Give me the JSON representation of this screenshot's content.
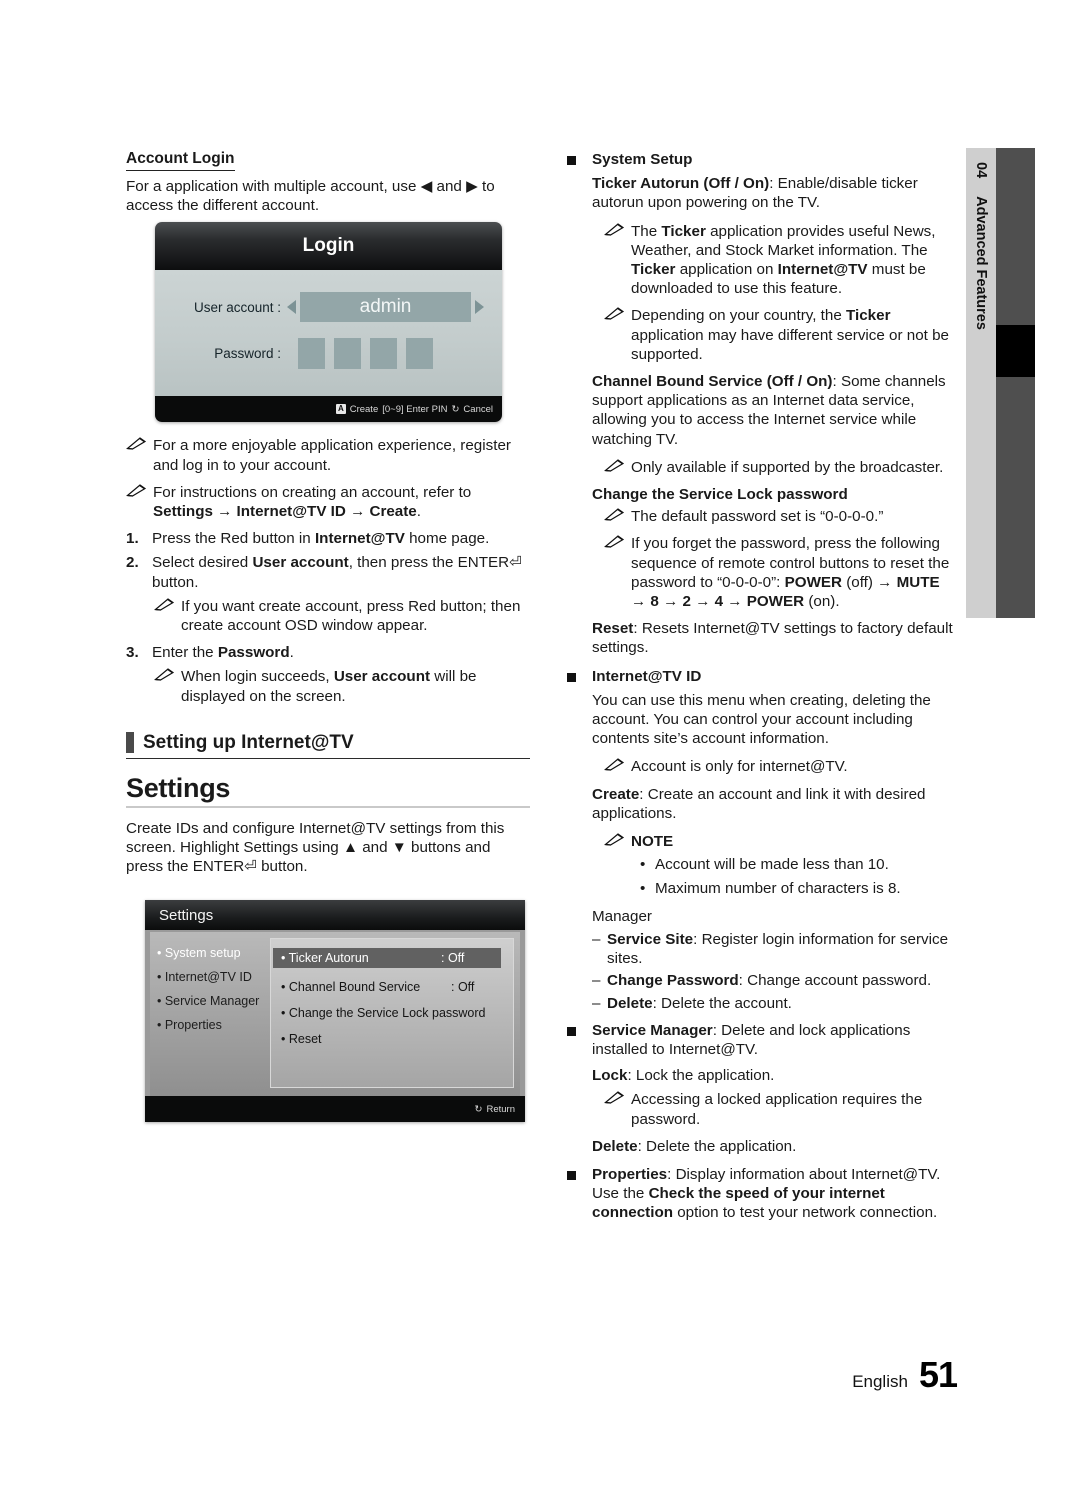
{
  "left": {
    "account_login_heading": "Account Login",
    "account_login_intro": "For a application with multiple account, use ◀ and ▶ to access the different account.",
    "login_osd": {
      "title": "Login",
      "user_account_label": "User account :",
      "user_account_value": "admin",
      "password_label": "Password :",
      "password_cells": 4,
      "footer_key": "A",
      "footer_create": "Create",
      "footer_enter_pin": "[0~9] Enter PIN",
      "footer_return_icon": "↻",
      "footer_cancel": "Cancel"
    },
    "notes": [
      "For a more enjoyable application experience, register and log in to your account.",
      "For instructions on creating an account, refer to Settings → Internet@TV ID → Create."
    ],
    "note2_plain_prefix": "For instructions on creating an account, refer to ",
    "note2_bold": "Settings → Internet@TV ID → Create",
    "steps": [
      {
        "n": "1.",
        "plain1": "Press the Red button in ",
        "bold": "Internet@TV",
        "plain2": " home page."
      },
      {
        "n": "2.",
        "plain1": "Select desired ",
        "bold": "User account",
        "plain2": ", then press the ENTER⏎ button."
      },
      {
        "n": "3.",
        "plain1": "Enter the ",
        "bold": "Password",
        "plain2": "."
      }
    ],
    "step2_note": "If you want create account, press Red button; then create account OSD window appear.",
    "step3_note_prefix": "When login succeeds, ",
    "step3_note_bold": "User account",
    "step3_note_suffix": " will be displayed on the screen.",
    "section_title": "Setting up Internet@TV",
    "settings_heading": "Settings",
    "settings_intro": "Create IDs and configure Internet@TV settings from this screen. Highlight Settings using ▲ and ▼ buttons and press the ENTER⏎ button.",
    "settings_osd": {
      "title": "Settings",
      "menu": [
        {
          "label": "• System setup",
          "selected": true
        },
        {
          "label": "• Internet@TV ID",
          "selected": false
        },
        {
          "label": "• Service Manager",
          "selected": false
        },
        {
          "label": "• Properties",
          "selected": false
        }
      ],
      "items": [
        {
          "label": "• Ticker Autorun",
          "value": ": Off",
          "highlight": true
        },
        {
          "label": "• Channel Bound Service",
          "value": ": Off",
          "highlight": false
        },
        {
          "label": "• Change the Service Lock password",
          "value": "",
          "highlight": false
        },
        {
          "label": "• Reset",
          "value": "",
          "highlight": false
        }
      ],
      "return_icon": "↻",
      "return_label": "Return"
    }
  },
  "right": {
    "system_setup_heading": "System Setup",
    "ticker_autorun_bold": "Ticker Autorun (Off / On)",
    "ticker_autorun_text": ": Enable/disable ticker autorun upon powering on the TV.",
    "ticker_note_1": "The Ticker application provides useful News, Weather, and Stock Market information. The Ticker application on Internet@TV must be downloaded to use this feature.",
    "ticker_note_2": "Depending on your country, the Ticker application may have different service or not be supported.",
    "channel_bound_bold": "Channel Bound Service (Off / On)",
    "channel_bound_text": ": Some channels support applications as an Internet data service, allowing you to access the Internet service while watching TV.",
    "channel_bound_note": "Only available if supported by the broadcaster.",
    "change_lock_heading": "Change the Service Lock password",
    "change_lock_note_1": "The default password set is “0-0-0-0.”",
    "change_lock_note_2": "If you forget the password, press the following sequence of remote control buttons to reset the password to “0-0-0-0”: POWER (off) → MUTE → 8 → 2 → 4 → POWER (on).",
    "reset_bold": "Reset",
    "reset_text": ": Resets Internet@TV settings to factory default settings.",
    "internet_tv_id_heading": "Internet@TV ID",
    "internet_tv_id_text": "You can use this menu when creating, deleting the account. You can control your account including contents site’s account information.",
    "internet_tv_id_note": "Account is only for internet@TV.",
    "create_bold": "Create",
    "create_text": ": Create an account and link it with desired applications.",
    "note_label": "NOTE",
    "note_bullets": [
      "Account will be made less than 10.",
      "Maximum number of characters is 8."
    ],
    "manager_heading": "Manager",
    "manager_items": [
      {
        "bold": "Service Site",
        "text": ": Register login information for service sites."
      },
      {
        "bold": "Change Password",
        "text": ": Change account password."
      },
      {
        "bold": "Delete",
        "text": ": Delete the account."
      }
    ],
    "service_manager_bold": "Service Manager",
    "service_manager_text": ": Delete and lock applications installed to Internet@TV.",
    "lock_bold": "Lock",
    "lock_text": ": Lock the application.",
    "lock_note": "Accessing a locked application requires the password.",
    "delete_bold": "Delete",
    "delete_text": ": Delete the application.",
    "properties_bold": "Properties",
    "properties_text_1": ": Display information about Internet@TV. Use the ",
    "properties_bold_2": "Check the speed of your internet connection",
    "properties_text_2": " option to test your network connection."
  },
  "index_tab": {
    "number": "04",
    "label": "Advanced Features"
  },
  "footer": {
    "language": "English",
    "page_number": "51"
  }
}
